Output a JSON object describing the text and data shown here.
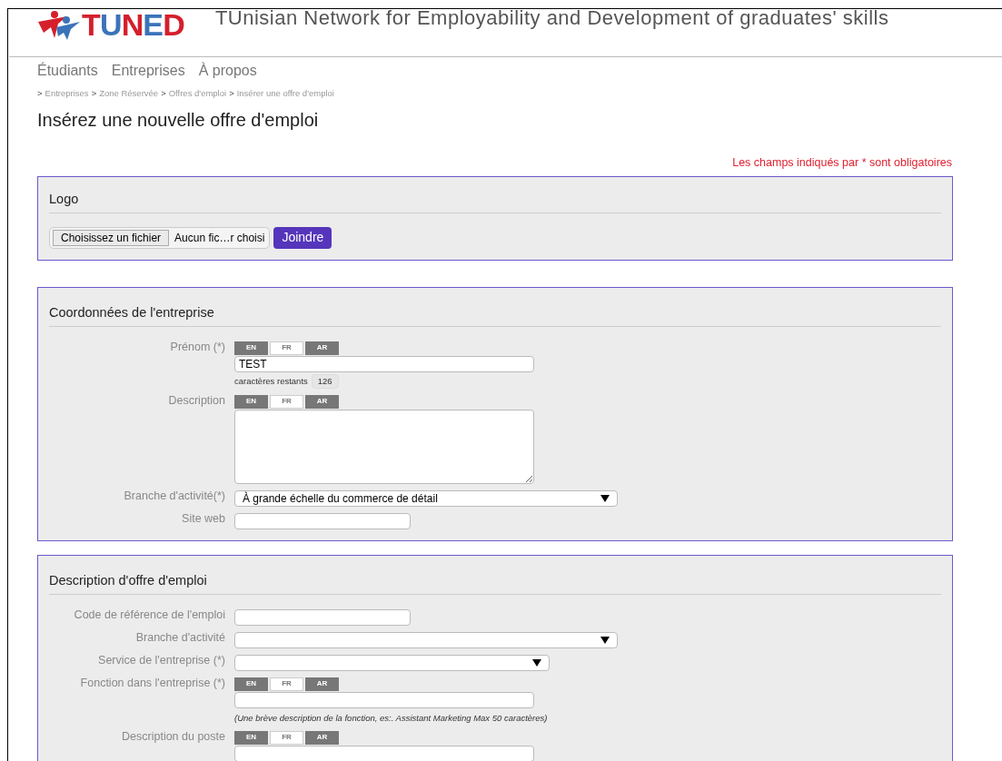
{
  "header": {
    "logo": "TUNED",
    "tagline": "TUnisian Network for Employability and Development of graduates' skills"
  },
  "nav": [
    "Étudiants",
    "Entreprises",
    "À propos"
  ],
  "breadcrumb": [
    {
      "sep": ">",
      "label": "Entreprises"
    },
    {
      "sep": ">",
      "label": "Zone Réservée"
    },
    {
      "sep": ">",
      "label": "Offres d'emploi"
    },
    {
      "sep": ">",
      "label": "Insérer une offre d'emploi"
    }
  ],
  "page_title": "Insérez une nouvelle offre d'emploi",
  "required_note": "Les champs indiqués par * sont obligatoires",
  "logo_section": {
    "title": "Logo",
    "file_button": "Choisissez un fichier",
    "file_status": "Aucun fic…r choisi",
    "submit": "Joindre"
  },
  "sections": [
    {
      "title": "Coordonnées de l'entreprise",
      "fields": [
        {
          "kind": "field",
          "label": "Prénom (*)",
          "lang_tabs": [
            {
              "label": "EN",
              "selected": false
            },
            {
              "label": "FR",
              "selected": true
            },
            {
              "label": "AR",
              "selected": false
            }
          ],
          "value": "TEST",
          "counter_label": "caractères restants",
          "counter": "126"
        },
        {
          "kind": "area",
          "label": "Description",
          "lang_tabs": [
            {
              "label": "EN",
              "selected": false
            },
            {
              "label": "FR",
              "selected": true
            },
            {
              "label": "AR",
              "selected": false
            }
          ]
        },
        {
          "kind": "select",
          "label": "Branche d'activité(*)",
          "value": "À grande échelle du commerce de détail"
        },
        {
          "kind": "shortfield",
          "label": "Site web"
        }
      ]
    },
    {
      "title": "Description d'offre d'emploi",
      "fields": [
        {
          "kind": "shortfield",
          "label": "Code de référence de l'emploi"
        },
        {
          "kind": "select",
          "label": "Branche d'activité"
        },
        {
          "kind": "smallselect",
          "label": "Service de l'entreprise (*)"
        },
        {
          "kind": "field",
          "label": "Fonction dans l'entreprise (*)",
          "lang_tabs": [
            {
              "label": "EN",
              "selected": false
            },
            {
              "label": "FR",
              "selected": true
            },
            {
              "label": "AR",
              "selected": false
            }
          ],
          "hint": "(Une brève description de la fonction, es:. Assistant Marketing Max 50 caractères)"
        },
        {
          "kind": "field",
          "label": "Description du poste",
          "lang_tabs": [
            {
              "label": "EN",
              "selected": false
            },
            {
              "label": "FR",
              "selected": true
            },
            {
              "label": "AR",
              "selected": false
            }
          ]
        }
      ]
    }
  ]
}
